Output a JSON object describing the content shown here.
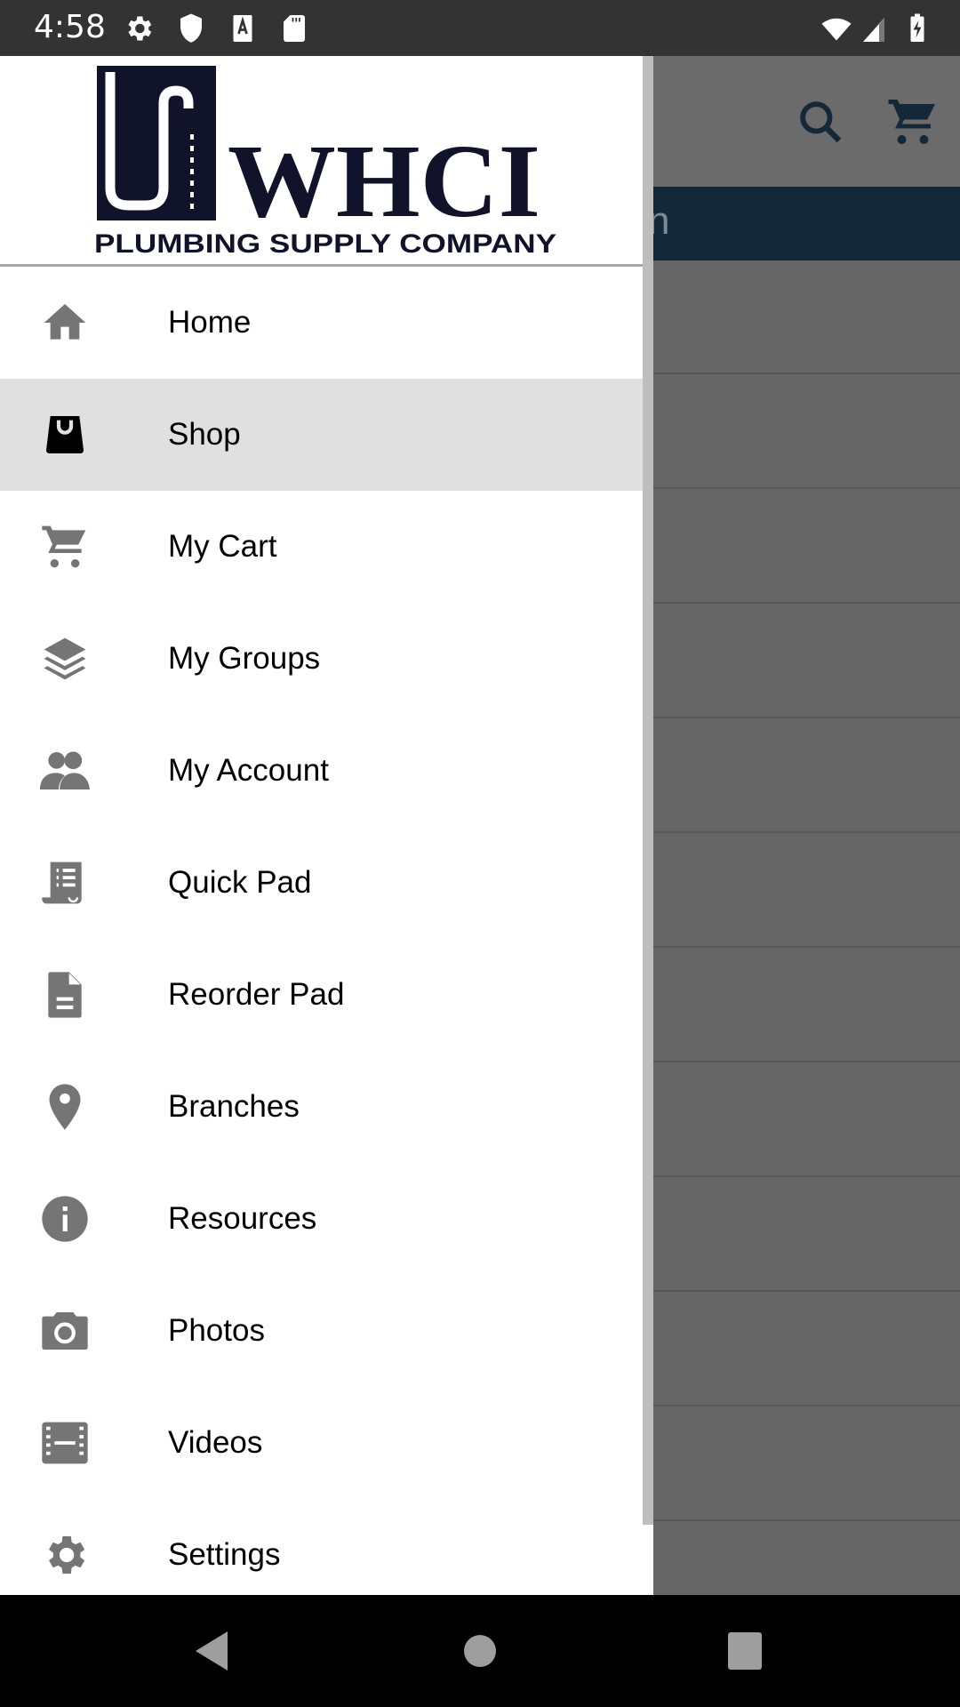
{
  "status_bar": {
    "time": "4:58",
    "left_icons": [
      "settings-icon",
      "shield-icon",
      "font-a-icon",
      "sd-card-icon"
    ],
    "right_icons": [
      "wifi-icon",
      "cell-signal-icon",
      "battery-charging-icon"
    ]
  },
  "background_app": {
    "toolbar_icons": [
      "search-icon",
      "cart-icon"
    ],
    "banner_partial_text": "n",
    "banner_color": "#132838",
    "icon_color": "#132838"
  },
  "drawer": {
    "logo": {
      "brand": "WHCI",
      "tagline": "PLUMBING SUPPLY COMPANY",
      "color": "#11132b"
    },
    "selected_index": 1,
    "items": [
      {
        "label": "Home",
        "icon": "home-icon"
      },
      {
        "label": "Shop",
        "icon": "shopping-bag-icon"
      },
      {
        "label": "My Cart",
        "icon": "cart-icon"
      },
      {
        "label": "My Groups",
        "icon": "layers-icon"
      },
      {
        "label": "My Account",
        "icon": "people-icon"
      },
      {
        "label": "Quick Pad",
        "icon": "receipt-list-icon"
      },
      {
        "label": "Reorder Pad",
        "icon": "document-icon"
      },
      {
        "label": "Branches",
        "icon": "location-pin-icon"
      },
      {
        "label": "Resources",
        "icon": "info-icon"
      },
      {
        "label": "Photos",
        "icon": "camera-icon"
      },
      {
        "label": "Videos",
        "icon": "film-icon"
      },
      {
        "label": "Settings",
        "icon": "settings-icon"
      }
    ],
    "icon_color": "#757575",
    "selected_icon_color": "#000000"
  },
  "nav_bar": {
    "buttons": [
      "back",
      "home",
      "recents"
    ]
  }
}
